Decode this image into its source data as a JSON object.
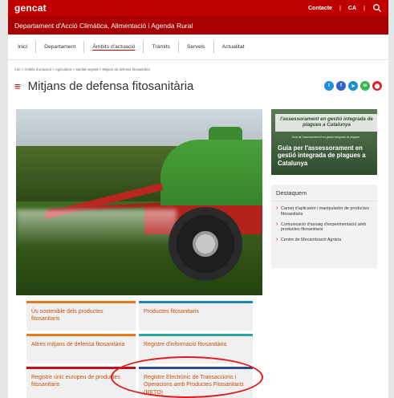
{
  "header": {
    "logo": "gencat",
    "contact_label": "Contacte",
    "separator": "|",
    "language": "CA",
    "search_icon": "search-icon"
  },
  "department": {
    "name": "Departament d'Acció Climàtica, Alimentació i Agenda Rural"
  },
  "nav": {
    "items": [
      {
        "label": "Inici"
      },
      {
        "label": "Departament"
      },
      {
        "label": "Àmbits d'actuació"
      },
      {
        "label": "Tràmits"
      },
      {
        "label": "Serveis"
      },
      {
        "label": "Actualitat"
      }
    ],
    "active": "Àmbits d'actuació"
  },
  "breadcrumb": {
    "text": "Inici > Àmbits d'actuació > Agricultura > Sanitat vegetal > Mitjans de defensa fitosanitària"
  },
  "page": {
    "menu_icon": "hamburger-icon",
    "title": "Mitjans de defensa fitosanitària"
  },
  "social": {
    "icons": [
      "twitter-icon",
      "facebook-icon",
      "telegram-icon",
      "whatsapp-icon",
      "share-icon"
    ],
    "colors": [
      "#1d8fe0",
      "#2e62c4",
      "#1f8fc8",
      "#3cb64a",
      "#d6262d"
    ]
  },
  "promo": {
    "banner": "l'assessorament en gestió integrada de plagues a Catalunya",
    "small": "Guia de l'assessorament en gestió integrada de plagues",
    "title": "Guia per l'assessorament en gestió integrada de plagues a Catalunya"
  },
  "highlights": {
    "title": "Destaquem",
    "items": [
      {
        "label": "Carnet d'aplicador i manipulador de productes fitosanitaris"
      },
      {
        "label": "Comunicació d'assaig d'experimentació amb productes fitosanitaris"
      },
      {
        "label": "Centre de Mecanització Agrària"
      }
    ]
  },
  "tiles": [
    {
      "label": "Ús sostenible dels productes fitosanitaris",
      "color": "#e8791a"
    },
    {
      "label": "Productes fitosanitaris",
      "color": "#1f83b8"
    },
    {
      "label": "Altres mitjans de defensa fitosanitària",
      "color": "#e8791a"
    },
    {
      "label": "Registre d'informació fitosanitària",
      "color": "#2aa59c"
    },
    {
      "label": "Registre únic europeu de productes fitosanitaris",
      "color": "#c70f1c"
    },
    {
      "label": "Registre Electrònic de Transaccions i Operacions amb Productes Fitosanitaris (RETO)",
      "color": "#2c4a8c"
    }
  ],
  "colors": {
    "brand_red": "#c00000",
    "annotation": "#e0191e"
  }
}
